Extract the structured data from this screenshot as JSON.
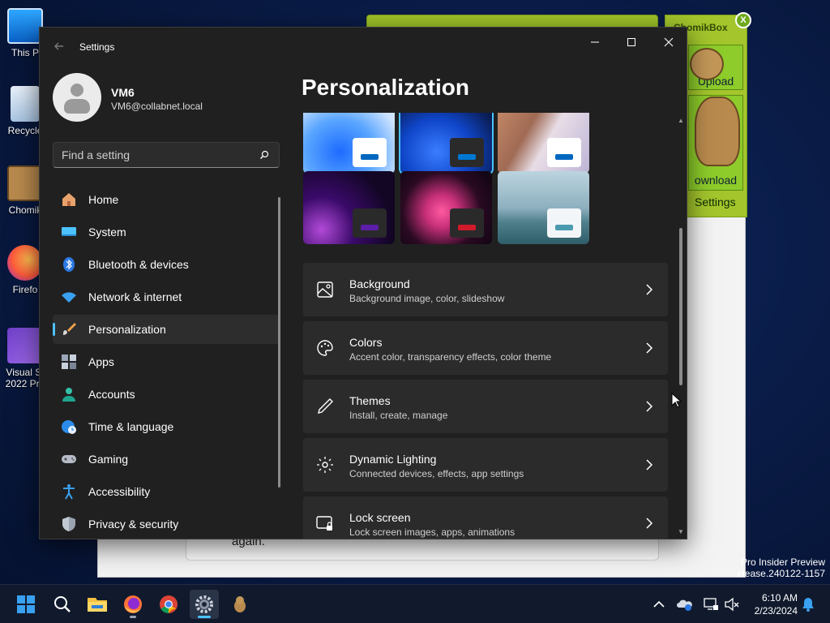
{
  "desktop": {
    "icons": [
      {
        "label": "This P"
      },
      {
        "label": "Recycle"
      },
      {
        "label": "Chomik"
      },
      {
        "label": "Firefo"
      },
      {
        "label": "Visual St",
        "label2": "2022 Pre"
      }
    ]
  },
  "background_window": {
    "partial_text": "again."
  },
  "chomikbox": {
    "title": "ChomikBox",
    "close_label": "X",
    "upload_label": "Upload",
    "download_label": "ownload",
    "settings_label": "Settings"
  },
  "watermark": {
    "line1": "Pro Insider Preview",
    "line2": "elease.240122-1157"
  },
  "settings": {
    "app_title": "Settings",
    "user": {
      "name": "VM6",
      "email": "VM6@collabnet.local"
    },
    "search": {
      "placeholder": "Find a setting",
      "value": ""
    },
    "nav": [
      {
        "label": "Home",
        "icon": "home-icon"
      },
      {
        "label": "System",
        "icon": "system-icon"
      },
      {
        "label": "Bluetooth & devices",
        "icon": "bluetooth-icon"
      },
      {
        "label": "Network & internet",
        "icon": "wifi-icon"
      },
      {
        "label": "Personalization",
        "icon": "brush-icon",
        "active": true
      },
      {
        "label": "Apps",
        "icon": "apps-icon"
      },
      {
        "label": "Accounts",
        "icon": "person-icon"
      },
      {
        "label": "Time & language",
        "icon": "globe-clock-icon"
      },
      {
        "label": "Gaming",
        "icon": "gamepad-icon"
      },
      {
        "label": "Accessibility",
        "icon": "accessibility-icon"
      },
      {
        "label": "Privacy & security",
        "icon": "shield-icon"
      }
    ],
    "page_title": "Personalization",
    "themes": [
      {
        "name": "windows-light",
        "accent": "#0067c0"
      },
      {
        "name": "windows-dark",
        "accent": "#0078d4",
        "selected": true
      },
      {
        "name": "captured-motion",
        "accent": "#0067c0"
      },
      {
        "name": "glow",
        "accent": "#5c1ea8"
      },
      {
        "name": "flow",
        "accent": "#d11a2a"
      },
      {
        "name": "sunrise",
        "accent": "#4a9bb0"
      }
    ],
    "options": [
      {
        "title": "Background",
        "subtitle": "Background image, color, slideshow",
        "icon": "image-icon"
      },
      {
        "title": "Colors",
        "subtitle": "Accent color, transparency effects, color theme",
        "icon": "palette-icon"
      },
      {
        "title": "Themes",
        "subtitle": "Install, create, manage",
        "icon": "pen-icon"
      },
      {
        "title": "Dynamic Lighting",
        "subtitle": "Connected devices, effects, app settings",
        "icon": "lighting-icon"
      },
      {
        "title": "Lock screen",
        "subtitle": "Lock screen images, apps, animations",
        "icon": "lock-screen-icon"
      }
    ]
  },
  "taskbar": {
    "apps": [
      "start",
      "search",
      "file-explorer",
      "firefox",
      "chrome",
      "settings",
      "chomikbox"
    ],
    "active_app": "settings",
    "clock": {
      "time": "6:10 AM",
      "date": "2/23/2024"
    }
  }
}
